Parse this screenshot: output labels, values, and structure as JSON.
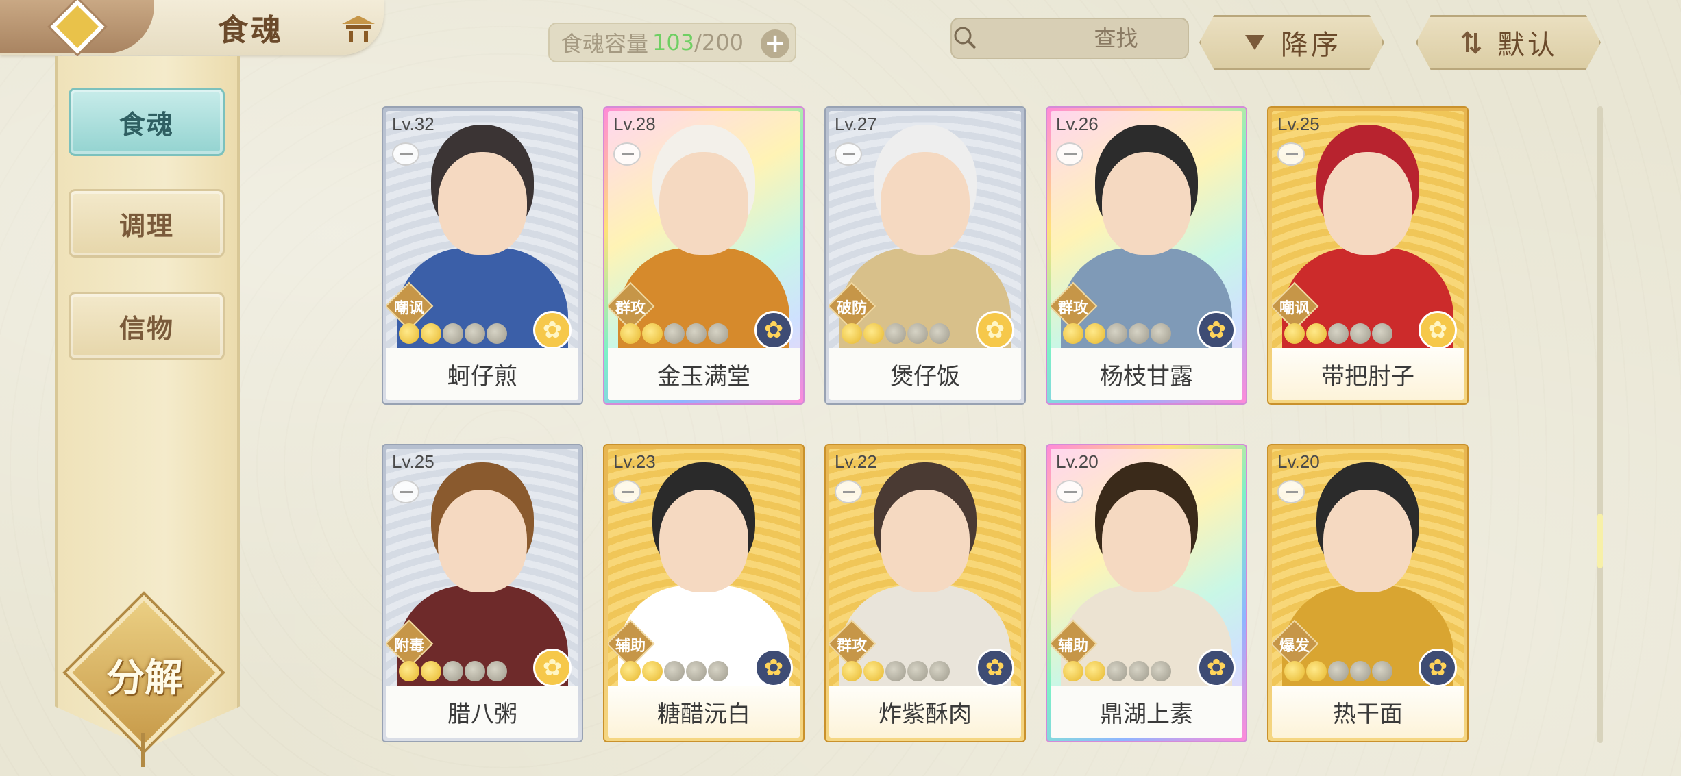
{
  "header": {
    "title": "食魂",
    "capacity": {
      "label": "食魂容量",
      "current": "103",
      "max": "/200"
    },
    "search": {
      "placeholder": "查找"
    },
    "sort_desc_label": "降序",
    "sort_default_label": "默认"
  },
  "sidebar": {
    "tabs": [
      {
        "label": "食魂",
        "active": true
      },
      {
        "label": "调理",
        "active": false
      },
      {
        "label": "信物",
        "active": false
      }
    ],
    "decompose_label": "分解"
  },
  "colors": {
    "accent_teal": "#93d3d0",
    "capacity_green": "#6fcf63",
    "frame_gold": "#e7b550",
    "frame_silver": "#b6bfcf"
  },
  "cards": [
    {
      "level": "Lv.32",
      "name": "蚵仔煎",
      "role": "嘲讽",
      "frame": "silver",
      "element": "gold",
      "stars": 2,
      "icon": "lotus-icon"
    },
    {
      "level": "Lv.28",
      "name": "金玉满堂",
      "role": "群攻",
      "frame": "rainbow",
      "element": "navy",
      "stars": 2,
      "icon": "flower-icon"
    },
    {
      "level": "Lv.27",
      "name": "煲仔饭",
      "role": "破防",
      "frame": "silver",
      "element": "gold",
      "stars": 2,
      "icon": "lotus-icon"
    },
    {
      "level": "Lv.26",
      "name": "杨枝甘露",
      "role": "群攻",
      "frame": "rainbow",
      "element": "navy",
      "stars": 2,
      "icon": "flower-icon"
    },
    {
      "level": "Lv.25",
      "name": "带把肘子",
      "role": "嘲讽",
      "frame": "gold",
      "element": "gold",
      "stars": 2,
      "icon": "lotus-icon"
    },
    {
      "level": "Lv.25",
      "name": "腊八粥",
      "role": "附毒",
      "frame": "silver",
      "element": "gold",
      "stars": 2,
      "icon": "lotus-icon"
    },
    {
      "level": "Lv.23",
      "name": "糖醋沅白",
      "role": "辅助",
      "frame": "gold",
      "element": "navy",
      "stars": 2,
      "icon": "flower-icon"
    },
    {
      "level": "Lv.22",
      "name": "炸紫酥肉",
      "role": "群攻",
      "frame": "gold",
      "element": "navy",
      "stars": 2,
      "icon": "flower-icon"
    },
    {
      "level": "Lv.20",
      "name": "鼎湖上素",
      "role": "辅助",
      "frame": "rainbow",
      "element": "navy",
      "stars": 2,
      "icon": "flower-icon"
    },
    {
      "level": "Lv.20",
      "name": "热干面",
      "role": "爆发",
      "frame": "gold",
      "element": "navy",
      "stars": 2,
      "icon": "flower-icon"
    }
  ],
  "scroll": {
    "position": 0.7
  }
}
